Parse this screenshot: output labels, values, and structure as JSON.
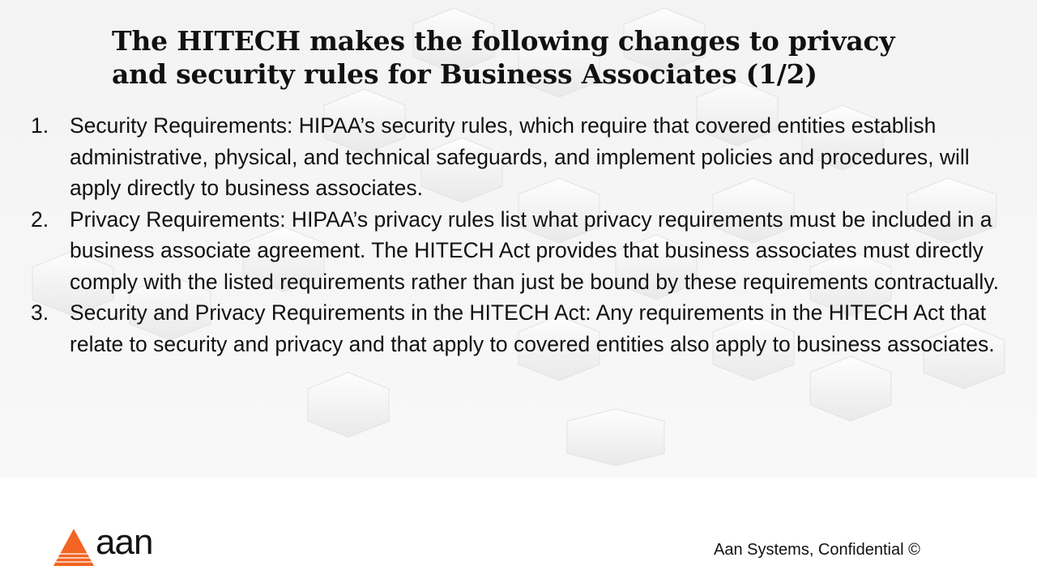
{
  "slide": {
    "title_line1": "The HITECH makes the following changes to privacy",
    "title_line2": "and security rules for Business Associates (1/2)",
    "items": [
      {
        "number": "1.",
        "text": "Security Requirements: HIPAA’s security rules, which require that covered entities establish administrative, physical, and technical safeguards, and implement policies and procedures, will apply directly to business associates."
      },
      {
        "number": "2.",
        "text": "Privacy Requirements: HIPAA’s privacy rules list what privacy requirements must be included in a business associate agreement.  The HITECH Act provides that business associates must directly comply with the listed requirements rather than just be bound by these requirements contractually."
      },
      {
        "number": "3.",
        "text": "Security and Privacy Requirements in the HITECH Act: Any requirements in the HITECH Act that relate to security and privacy and that apply to covered entities also apply to business associates."
      }
    ]
  },
  "footer": {
    "logo_text": "aan",
    "logo_color": "#f26522",
    "confidential": "Aan Systems, Confidential ©"
  }
}
